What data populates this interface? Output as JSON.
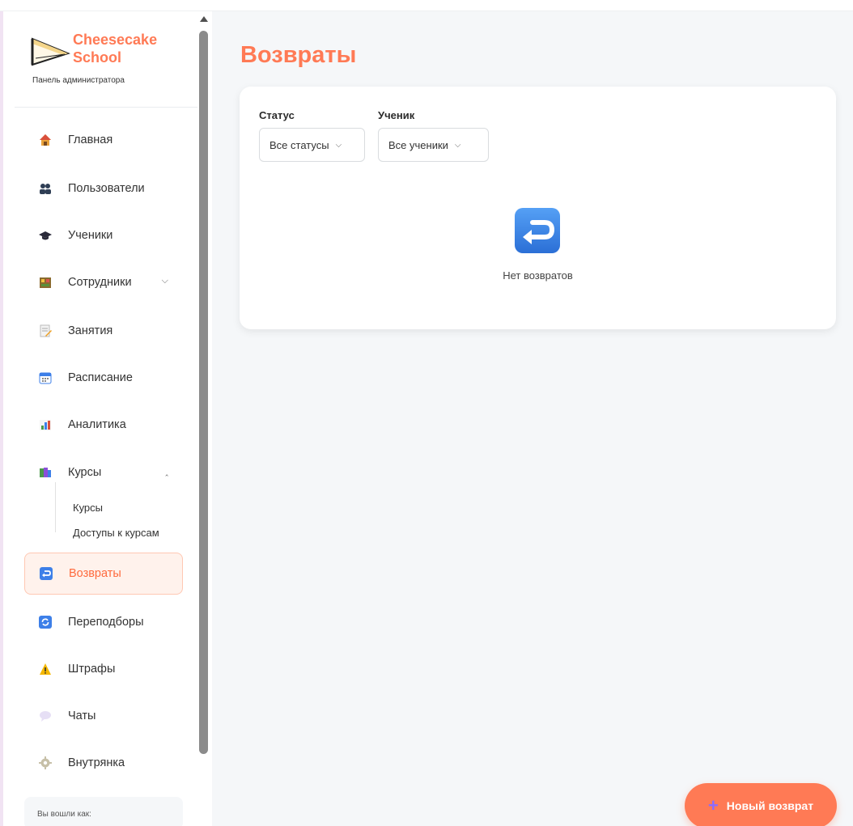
{
  "brand": {
    "name": "Cheesecake School",
    "subtitle": "Панель администратора"
  },
  "nav": {
    "items": [
      {
        "label": "Главная",
        "icon": "house-icon"
      },
      {
        "label": "Пользователи",
        "icon": "users-icon"
      },
      {
        "label": "Ученики",
        "icon": "graduation-cap-icon"
      },
      {
        "label": "Сотрудники",
        "icon": "staff-icon",
        "chevron": "down"
      },
      {
        "label": "Занятия",
        "icon": "memo-icon"
      },
      {
        "label": "Расписание",
        "icon": "calendar-icon"
      },
      {
        "label": "Аналитика",
        "icon": "bar-chart-icon"
      },
      {
        "label": "Курсы",
        "icon": "books-icon",
        "chevron": "up"
      },
      {
        "label": "Возвраты",
        "icon": "return-arrow-icon",
        "active": true
      },
      {
        "label": "Переподборы",
        "icon": "refresh-icon"
      },
      {
        "label": "Штрафы",
        "icon": "warning-icon"
      },
      {
        "label": "Чаты",
        "icon": "speech-bubble-icon"
      },
      {
        "label": "Внутрянка",
        "icon": "gear-icon"
      }
    ],
    "courses_sub": [
      "Курсы",
      "Доступы к курсам"
    ]
  },
  "login": {
    "label": "Вы вошли как:"
  },
  "page": {
    "title": "Возвраты",
    "filters": {
      "status_label": "Статус",
      "status_value": "Все статусы",
      "student_label": "Ученик",
      "student_value": "Все ученики"
    },
    "empty_text": "Нет возвратов",
    "new_button": "Новый возврат"
  },
  "colors": {
    "accent": "#ff7a55",
    "active_bg": "#fff2ec",
    "icon_blue": "#3d7fe8"
  }
}
